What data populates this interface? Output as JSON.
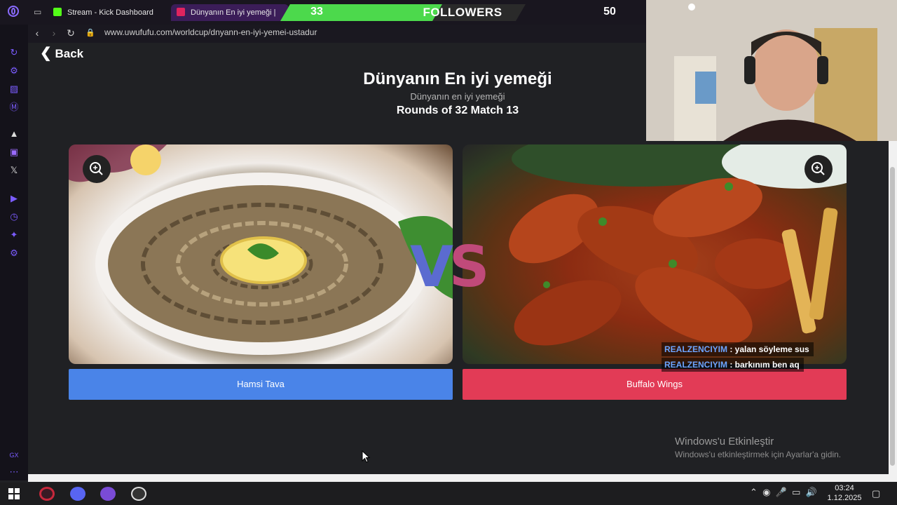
{
  "browser": {
    "tabs": [
      {
        "title": "Stream - Kick Dashboard",
        "favicon_color": "#53fc18"
      },
      {
        "title": "Dünyanın En iyi yemeği |",
        "favicon_color": "#e0245e",
        "active": true
      }
    ],
    "url": "www.uwufufu.com/worldcup/dnyann-en-iyi-yemei-ustadur"
  },
  "overlay": {
    "followers_current": "33",
    "followers_label": "FOLLOWERS",
    "followers_goal": "50",
    "progress_fraction": 0.66,
    "progress_color": "#4cd94c"
  },
  "page": {
    "back_label": "Back",
    "title": "Dünyanın En iyi yemeği",
    "subtitle": "Dünyanın en iyi yemeği",
    "round_info": "Rounds of 32 Match 13",
    "vs_text_v": "V",
    "vs_text_s": "S",
    "choices": [
      {
        "label": "Hamsi Tava",
        "color": "#4a84e8"
      },
      {
        "label": "Buffalo Wings",
        "color": "#e23b56"
      }
    ]
  },
  "chat": [
    {
      "user": "REALZENCIYIM",
      "message": " : yalan söyleme sus",
      "user_color": "#6ea5ff"
    },
    {
      "user": "REALZENCIYIM",
      "message": " : barkınım ben aq",
      "user_color": "#6ea5ff"
    }
  ],
  "watermark": {
    "title": "Windows'u Etkinleştir",
    "subtitle": "Windows'u etkinleştirmek için Ayarlar'a gidin."
  },
  "taskbar": {
    "time": "03:24",
    "date": "1.12.2025"
  }
}
